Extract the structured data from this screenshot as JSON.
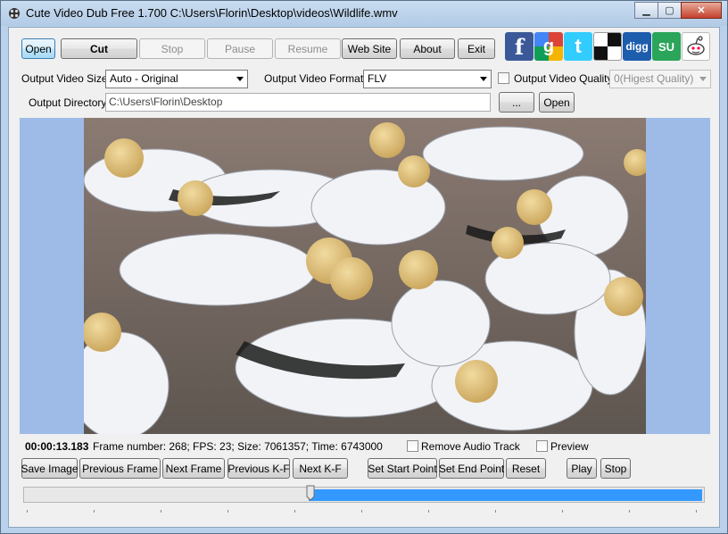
{
  "window": {
    "title": "Cute Video Dub Free 1.700  C:\\Users\\Florin\\Desktop\\videos\\Wildlife.wmv",
    "min_glyph": "▁",
    "max_glyph": "▢",
    "close_glyph": "✕"
  },
  "toolbar": {
    "open": "Open",
    "cut": "Cut",
    "stop": "Stop",
    "pause": "Pause",
    "resume": "Resume",
    "website": "Web Site",
    "about": "About",
    "exit": "Exit"
  },
  "social": {
    "facebook": "f",
    "google": "g",
    "twitter": "t",
    "digg": "digg",
    "stumble": "SU"
  },
  "settings": {
    "size_label": "Output Video Size:",
    "size_value": "Auto - Original",
    "format_label": "Output Video Format:",
    "format_value": "FLV",
    "quality_label": "Output Video Quality",
    "quality_value": "0(Higest Quality)",
    "dir_label": "Output Directory:",
    "dir_value": "C:\\Users\\Florin\\Desktop",
    "browse": "...",
    "open_dir": "Open"
  },
  "status": {
    "time": "00:00:13.183",
    "info": "Frame number: 268; FPS: 23; Size: 7061357; Time: 6743000",
    "remove_audio": "Remove Audio Track",
    "preview": "Preview"
  },
  "controls": {
    "save_image": "Save Image",
    "prev_frame": "Previous Frame",
    "next_frame": "Next Frame",
    "prev_kf": "Previous K-F",
    "next_kf": "Next K-F",
    "set_start": "Set  Start Point",
    "set_end": "Set  End Point",
    "reset": "Reset",
    "play": "Play",
    "stop": "Stop"
  },
  "slider": {
    "position_fraction": 0.42,
    "selection_start_fraction": 0.42,
    "selection_end_fraction": 1.0
  },
  "colors": {
    "accent": "#3399ff",
    "facebook": "#3b5998",
    "twitter": "#33ccff",
    "digg": "#1d5dad",
    "stumble": "#2aa55a"
  }
}
